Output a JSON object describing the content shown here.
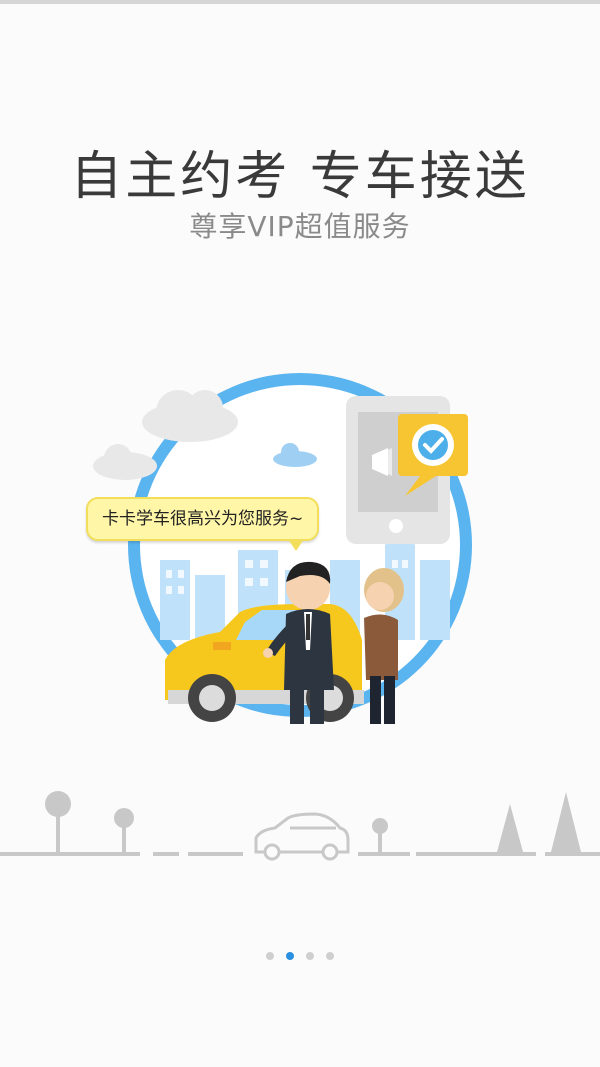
{
  "headline": "自主约考  专车接送",
  "subheadline": "尊享VIP超值服务",
  "speech_bubble": "卡卡学车很高兴为您服务~",
  "pager": {
    "count": 4,
    "active_index": 1
  },
  "colors": {
    "accent": "#2a8fe0",
    "circle_blue": "#5ab4f0",
    "taxi_yellow": "#f6c81e",
    "check_yellow": "#f6c531",
    "road_gray": "#c8c8c8"
  }
}
